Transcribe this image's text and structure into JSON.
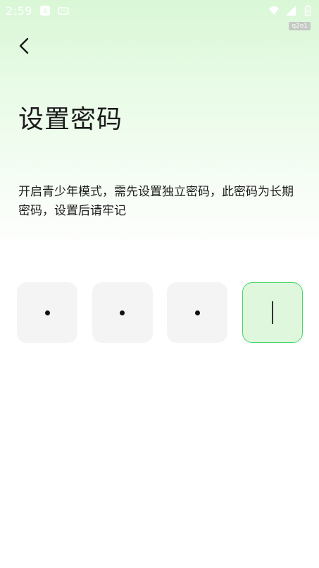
{
  "status_bar": {
    "time": "2:59",
    "icons": [
      "a-notification-icon",
      "sim-card-icon",
      "wifi-icon",
      "signal-icon",
      "battery-icon"
    ]
  },
  "tag": "q2o1",
  "header": {
    "back_icon": "chevron-left-icon"
  },
  "title": "设置密码",
  "description": "开启青少年模式，需先设置独立密码，此密码为长期密码，设置后请牢记",
  "pin": {
    "length": 4,
    "filled_count": 3,
    "active_index": 3
  },
  "colors": {
    "accent": "#46d46a",
    "box_bg": "#f4f4f4"
  }
}
